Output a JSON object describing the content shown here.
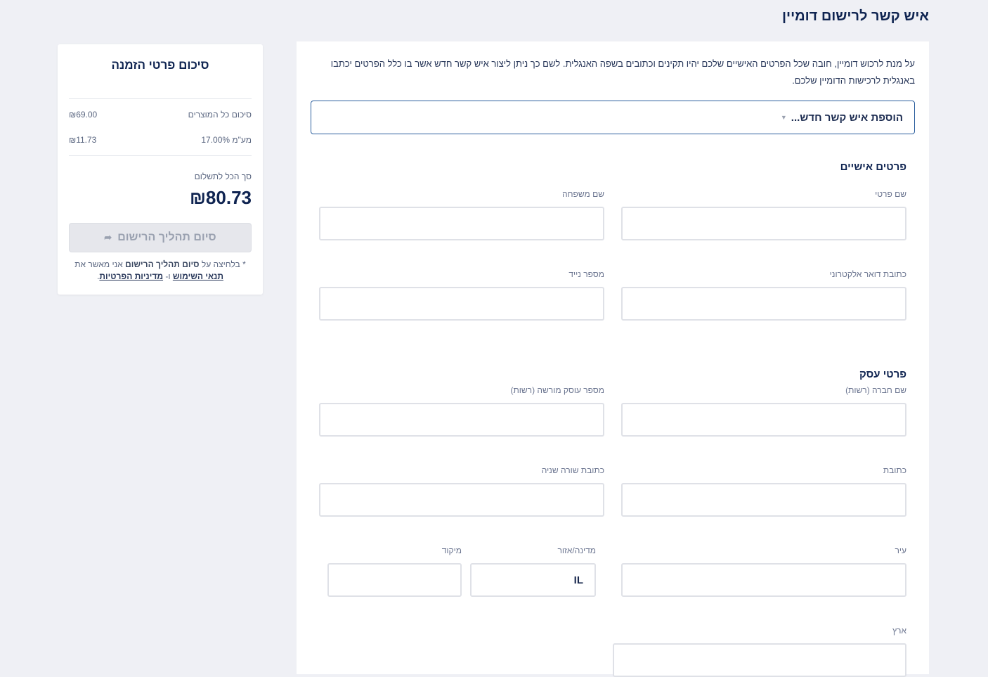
{
  "page": {
    "title": "איש קשר לרישום דומיין"
  },
  "summary": {
    "title": "סיכום פרטי הזמנה",
    "subtotal_label": "סיכום כל המוצרים",
    "subtotal_value": "₪69.00",
    "vat_label": "מע\"מ 17.00%",
    "vat_value": "₪11.73",
    "total_label": "סך הכל לתשלום",
    "total_value": "₪80.73",
    "finish_label": "סיום תהליך הרישום",
    "terms_prefix": "* בלחיצה על",
    "terms_bold": "סיום תהליך הרישום",
    "terms_mid": "אני מאשר את",
    "terms_link": "תנאי השימוש",
    "terms_and": "ו-",
    "privacy_link": "מדיניות הפרטיות",
    "terms_end": "."
  },
  "form": {
    "intro": "על מנת לרכוש דומיין, חובה שכל הפרטים האישיים שלכם יהיו תקינים וכתובים בשפה האנגלית. לשם כך ניתן ליצור איש קשר חדש אשר בו כלל הפרטים יכתבו באנגלית לרכישות הדומיין שלכם.",
    "contact_select": "הוספת איש קשר חדש...",
    "personal_title": "פרטים אישיים",
    "first_name": "שם פרטי",
    "last_name": "שם משפחה",
    "email": "כתובת דואר אלקטרוני",
    "mobile": "מספר נייד",
    "business_title": "פרטי עסק",
    "company": "שם חברה (רשות)",
    "vat_id": "מספר עוסק מורשה (רשות)",
    "address": "כתובת",
    "address2": "כתובת שורה שניה",
    "city": "עיר",
    "state": "מדינה/אזור",
    "state_value": "IL",
    "zip": "מיקוד",
    "country": "ארץ"
  }
}
